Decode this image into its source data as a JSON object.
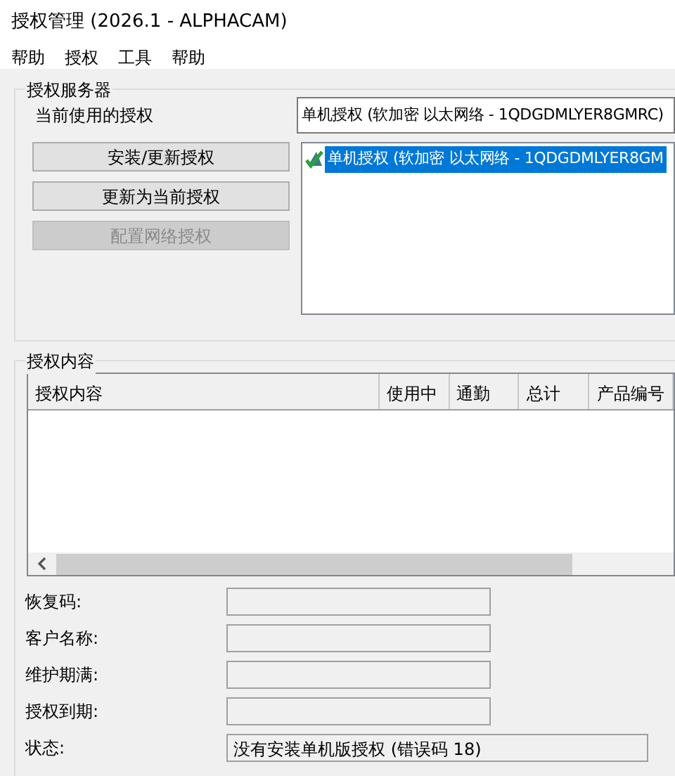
{
  "window": {
    "title": "授权管理 (2026.1 - ALPHACAM)"
  },
  "menu": [
    "帮助",
    "授权",
    "工具",
    "帮助"
  ],
  "server_group": {
    "title": "授权服务器",
    "current_label": "当前使用的授权",
    "current_value": "单机授权 (软加密 以太网络 - 1QDGDMLYER8GMRC)",
    "buttons": [
      {
        "label": "安装/更新授权",
        "disabled": false
      },
      {
        "label": "更新为当前授权",
        "disabled": false
      },
      {
        "label": "配置网络授权",
        "disabled": true
      }
    ],
    "licenses": [
      {
        "label": "单机授权 (软加密 以太网络 - 1QDGDMLYER8GM",
        "selected": true
      }
    ]
  },
  "content_group": {
    "title": "授权内容",
    "columns": [
      "授权内容",
      "使用中",
      "通勤",
      "总计",
      "产品编号"
    ],
    "fields": [
      {
        "label": "恢复码:"
      },
      {
        "label": "客户名称:"
      },
      {
        "label": "维护期满:"
      },
      {
        "label": "授权到期:"
      },
      {
        "label": "状态:",
        "value": "没有安装单机版授权 (错误码 18)"
      }
    ]
  }
}
